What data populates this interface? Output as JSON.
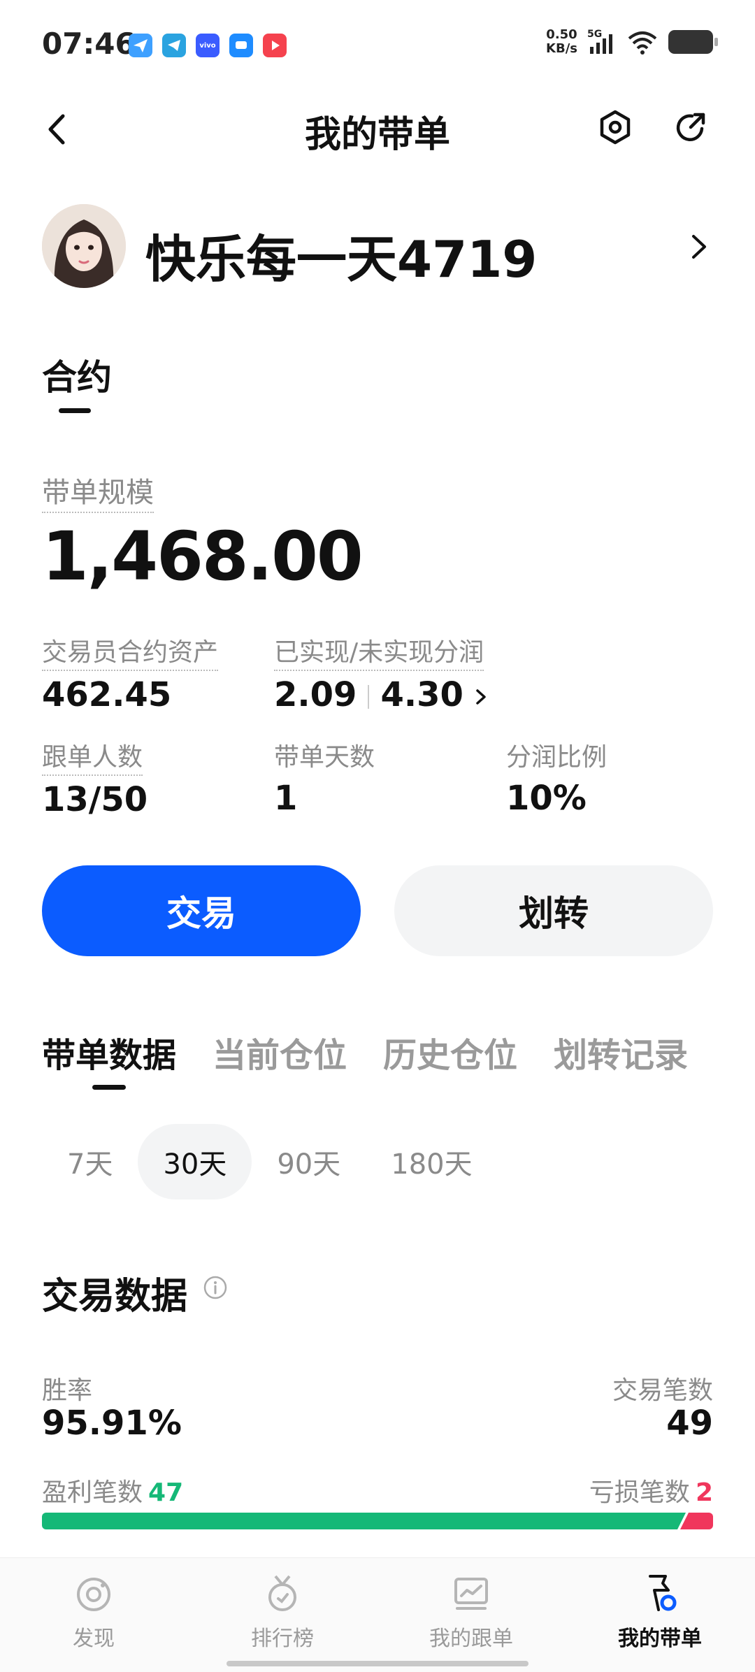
{
  "status_bar": {
    "time": "07:46",
    "net_speed_value": "0.50",
    "net_speed_unit": "KB/s",
    "network": "5G",
    "icons": [
      "send-app-icon",
      "telegram-icon",
      "vivo-icon",
      "chat-app-icon",
      "video-app-icon",
      "signal-icon",
      "wifi-icon",
      "battery-icon"
    ]
  },
  "header": {
    "title": "我的带单"
  },
  "profile": {
    "username": "快乐每一天4719"
  },
  "contract_tab": "合约",
  "summary": {
    "scale_label": "带单规模",
    "scale_value": "1,468.00",
    "assets_label": "交易员合约资产",
    "assets_value": "462.45",
    "share_label": "已实现/未实现分润",
    "realized": "2.09",
    "unrealized": "4.30",
    "followers_label": "跟单人数",
    "followers_value": "13/50",
    "days_label": "带单天数",
    "days_value": "1",
    "ratio_label": "分润比例",
    "ratio_value": "10%"
  },
  "actions": {
    "trade": "交易",
    "transfer": "划转"
  },
  "tabs": [
    "带单数据",
    "当前仓位",
    "历史仓位",
    "划转记录"
  ],
  "periods": [
    "7天",
    "30天",
    "90天",
    "180天"
  ],
  "selected_period": "30天",
  "trade_data": {
    "title": "交易数据",
    "win_rate_label": "胜率",
    "win_rate_value": "95.91%",
    "trade_count_label": "交易笔数",
    "trade_count_value": "49",
    "profit_label": "盈利笔数",
    "profit_count": "47",
    "loss_label": "亏损笔数",
    "loss_count": "2",
    "win_fraction": 0.9591
  },
  "colors": {
    "accent": "#0b5cff",
    "profit": "#15b877",
    "loss": "#f0365c"
  },
  "bottom_nav": [
    "发现",
    "排行榜",
    "我的跟单",
    "我的带单"
  ],
  "active_nav": "我的带单"
}
